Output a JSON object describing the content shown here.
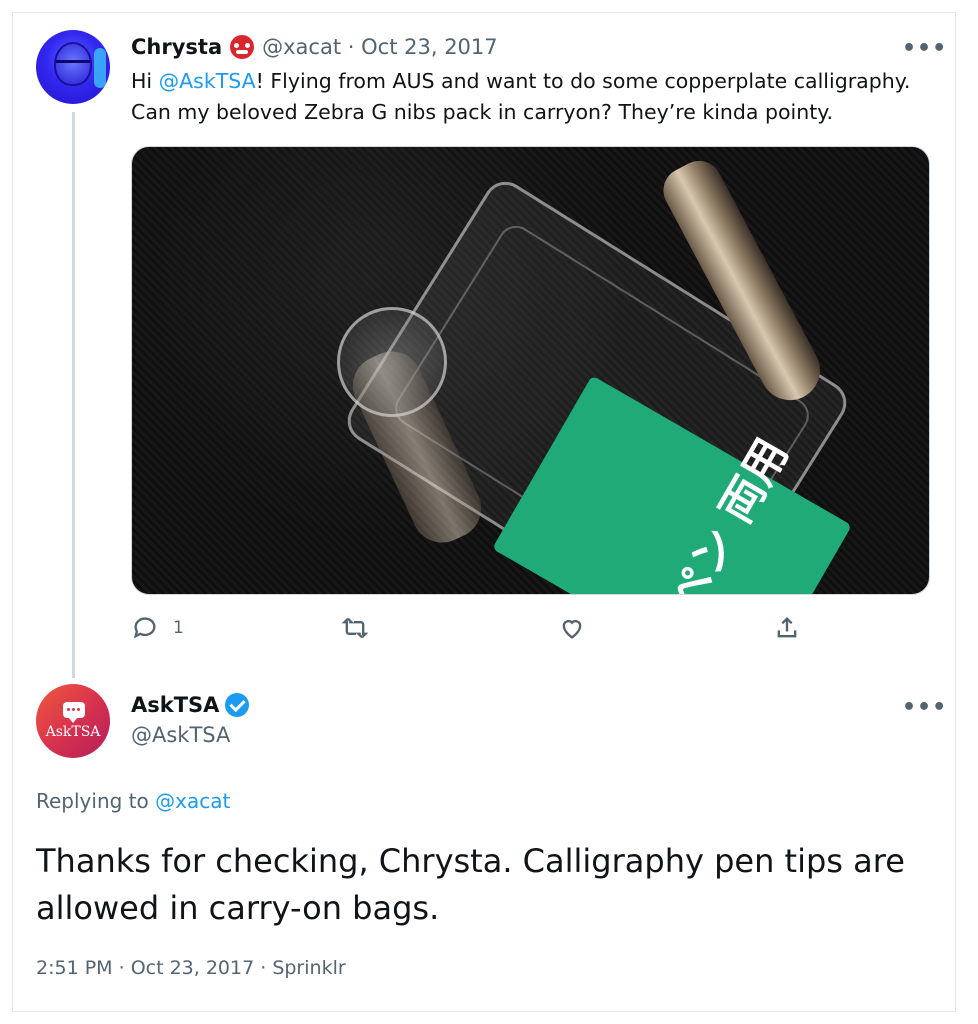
{
  "tweet1": {
    "name": "Chrysta",
    "name_emoji_icon": "ogre-icon",
    "handle": "@xacat",
    "separator": "·",
    "date": "Oct 23, 2017",
    "text_before": "Hi ",
    "mention": "@AskTSA",
    "text_after": "! Flying from AUS and want to do some copperplate calligraphy. Can my beloved Zebra G nibs pack in carryon? They’re kinda pointy.",
    "media_label_text": "Gペン 両用",
    "actions": {
      "reply_count": "1",
      "retweet_count": "",
      "like_count": ""
    }
  },
  "tweet2": {
    "name": "AskTSA",
    "handle": "@AskTSA",
    "avatar_text": "AskTSA",
    "replying_prefix": "Replying to ",
    "replying_to": "@xacat",
    "body": "Thanks for checking, Chrysta. Calligraphy pen tips are allowed in carry-on bags.",
    "time": "2:51 PM",
    "date": "Oct 23, 2017",
    "source": "Sprinklr",
    "meta_separator": " · "
  },
  "more_label": "•••",
  "colors": {
    "accent": "#1d9bf0",
    "muted": "#536471",
    "text": "#0f1419"
  }
}
